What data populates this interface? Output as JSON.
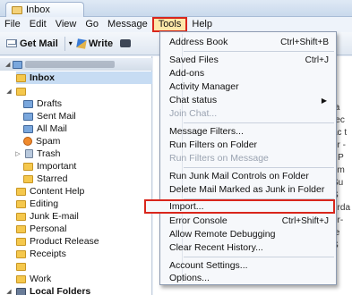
{
  "window": {
    "tab_title": "Inbox"
  },
  "menubar": [
    "File",
    "Edit",
    "View",
    "Go",
    "Message",
    "Tools",
    "Help"
  ],
  "toolbar": {
    "get_mail": "Get Mail",
    "write": "Write"
  },
  "folders": [
    {
      "label": "Inbox",
      "icon": "inbox-icon"
    },
    {
      "label": "Drafts",
      "icon": "drafts-folder-icon"
    },
    {
      "label": "Sent Mail",
      "icon": "sent-folder-icon"
    },
    {
      "label": "All Mail",
      "icon": "all-mail-folder-icon"
    },
    {
      "label": "Spam",
      "icon": "spam-folder-icon"
    },
    {
      "label": "Trash",
      "icon": "trash-folder-icon"
    },
    {
      "label": "Important",
      "icon": "folder-icon"
    },
    {
      "label": "Starred",
      "icon": "folder-icon"
    },
    {
      "label": "Content Help",
      "icon": "folder-icon"
    },
    {
      "label": "Editing",
      "icon": "folder-icon"
    },
    {
      "label": "Junk E-mail",
      "icon": "folder-icon"
    },
    {
      "label": "Personal",
      "icon": "folder-icon"
    },
    {
      "label": "Product Release",
      "icon": "folder-icon"
    },
    {
      "label": "Receipts",
      "icon": "folder-icon"
    },
    {
      "label": "Work",
      "icon": "folder-icon"
    },
    {
      "label": "Local Folders",
      "icon": "local-folders-icon"
    }
  ],
  "message_fragments": [
    "-",
    "ta",
    "rec",
    "ac t",
    "er -",
    "- P",
    "em",
    "Su",
    "S",
    "urda",
    "er-",
    "te",
    "S"
  ],
  "tools_menu": [
    {
      "label": "Address Book",
      "shortcut": "Ctrl+Shift+B"
    },
    {
      "label": "Saved Files",
      "shortcut": "Ctrl+J"
    },
    {
      "label": "Add-ons",
      "shortcut": ""
    },
    {
      "label": "Activity Manager",
      "shortcut": ""
    },
    {
      "label": "Chat status",
      "shortcut": ""
    },
    {
      "label": "Join Chat...",
      "shortcut": ""
    },
    {
      "label": "Message Filters...",
      "shortcut": ""
    },
    {
      "label": "Run Filters on Folder",
      "shortcut": ""
    },
    {
      "label": "Run Filters on Message",
      "shortcut": ""
    },
    {
      "label": "Run Junk Mail Controls on Folder",
      "shortcut": ""
    },
    {
      "label": "Delete Mail Marked as Junk in Folder",
      "shortcut": ""
    },
    {
      "label": "Import...",
      "shortcut": ""
    },
    {
      "label": "Error Console",
      "shortcut": "Ctrl+Shift+J"
    },
    {
      "label": "Allow Remote Debugging",
      "shortcut": ""
    },
    {
      "label": "Clear Recent History...",
      "shortcut": ""
    },
    {
      "label": "Account Settings...",
      "shortcut": ""
    },
    {
      "label": "Options...",
      "shortcut": ""
    }
  ],
  "colors": {
    "highlight": "#d9261c",
    "active_menu_bg": "#fde7a8",
    "folder": "#f5c84d"
  }
}
